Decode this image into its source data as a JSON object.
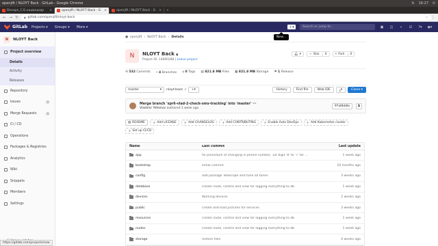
{
  "browser": {
    "window_title": "openjift / NLOYT Back · GitLab - Google Chrome",
    "clock": "16:27",
    "tabs": [
      {
        "label": "Devops_С.Б.ешдицидр"
      },
      {
        "label": "openjift / NLOYT Back · G"
      },
      {
        "label": "openjift / NLOYT Back · G"
      }
    ],
    "url": "gitlab.com/openjift/nloyt-back",
    "status_url": "https://gitlab.com/projects/new"
  },
  "gitlab": {
    "brand": "GitLab",
    "menu": [
      "Projects",
      "Groups",
      "More"
    ],
    "search_placeholder": "Search or jump to...",
    "tooltip": "New..."
  },
  "sidebar": {
    "project_initial": "N",
    "project_name": "NLOYT Back",
    "overview": "Project overview",
    "overview_sub": [
      "Details",
      "Activity",
      "Releases"
    ],
    "items": [
      {
        "label": "Repository",
        "count": ""
      },
      {
        "label": "Issues",
        "count": "0"
      },
      {
        "label": "Merge Requests",
        "count": "0"
      },
      {
        "label": "CI / CD",
        "count": ""
      },
      {
        "label": "Operations",
        "count": ""
      },
      {
        "label": "Packages & Registries",
        "count": ""
      },
      {
        "label": "Analytics",
        "count": ""
      },
      {
        "label": "Wiki",
        "count": ""
      },
      {
        "label": "Snippets",
        "count": ""
      },
      {
        "label": "Members",
        "count": ""
      },
      {
        "label": "Settings",
        "count": ""
      }
    ],
    "collapse": "Collapse sidebar"
  },
  "breadcrumb": {
    "group": "openjift",
    "project": "NLOYT Back",
    "page": "Details"
  },
  "project": {
    "initial": "N",
    "name": "NLOYT Back",
    "id_text": "Project ID: 14890288",
    "leave": "Leave project",
    "star_label": "Star",
    "star_count": "0",
    "fork_label": "Fork",
    "fork_count": "0"
  },
  "stats": [
    {
      "value": "532",
      "label": "Commits"
    },
    {
      "value": "4",
      "label": "Branches"
    },
    {
      "value": "0",
      "label": "Tags"
    },
    {
      "value": "821.8 MB",
      "label": "Files"
    },
    {
      "value": "821.8 MB",
      "label": "Storage"
    },
    {
      "value": "1",
      "label": "Release"
    }
  ],
  "toolbar": {
    "branch": "master",
    "path": "nloyt-back",
    "separator": "/",
    "add": "+",
    "history": "History",
    "find_file": "Find file",
    "web_ide": "Web IDE",
    "clone": "Clone"
  },
  "commit": {
    "message": "Merge branch 'spr6-vlad-2-check-sms-tracking' into 'master'",
    "author": "Vladimir Yefemov",
    "meta": "authored 1 week ago",
    "sha": "9fa8bb8a"
  },
  "quick_actions": [
    {
      "label": "README",
      "dashed": false
    },
    {
      "label": "Add LICENSE",
      "dashed": true
    },
    {
      "label": "Add CHANGELOG",
      "dashed": true
    },
    {
      "label": "Add CONTRIBUTING",
      "dashed": true
    },
    {
      "label": "Enable Auto DevOps",
      "dashed": true
    },
    {
      "label": "Add Kubernetes cluster",
      "dashed": true
    },
    {
      "label": "Set up CI/CD",
      "dashed": true
    }
  ],
  "files_table": {
    "headers": [
      "Name",
      "Last commit",
      "Last update"
    ],
    "rows": [
      {
        "name": "app",
        "commit": "fix procedure of changing in phone number, 1st digit '8' to '7' for ...",
        "updated": "1 week ago"
      },
      {
        "name": "bootstrap",
        "commit": "Initial commit",
        "updated": "10 months ago"
      },
      {
        "name": "config",
        "commit": "add package Telescope and tune all tunes",
        "updated": "3 weeks ago"
      },
      {
        "name": "database",
        "commit": "create route, control and view for logging everything to db",
        "updated": "1 week ago"
      },
      {
        "name": "devices",
        "commit": "Working devices",
        "updated": "2 weeks ago"
      },
      {
        "name": "public",
        "commit": "create and load pictures for services",
        "updated": "3 weeks ago"
      },
      {
        "name": "resources",
        "commit": "create route, control and view for logging everything to db",
        "updated": "1 week ago"
      },
      {
        "name": "routes",
        "commit": "create route, control and view for logging everything to db",
        "updated": "1 week ago"
      },
      {
        "name": "storage",
        "commit": "restore files",
        "updated": "4 weeks ago"
      }
    ]
  }
}
